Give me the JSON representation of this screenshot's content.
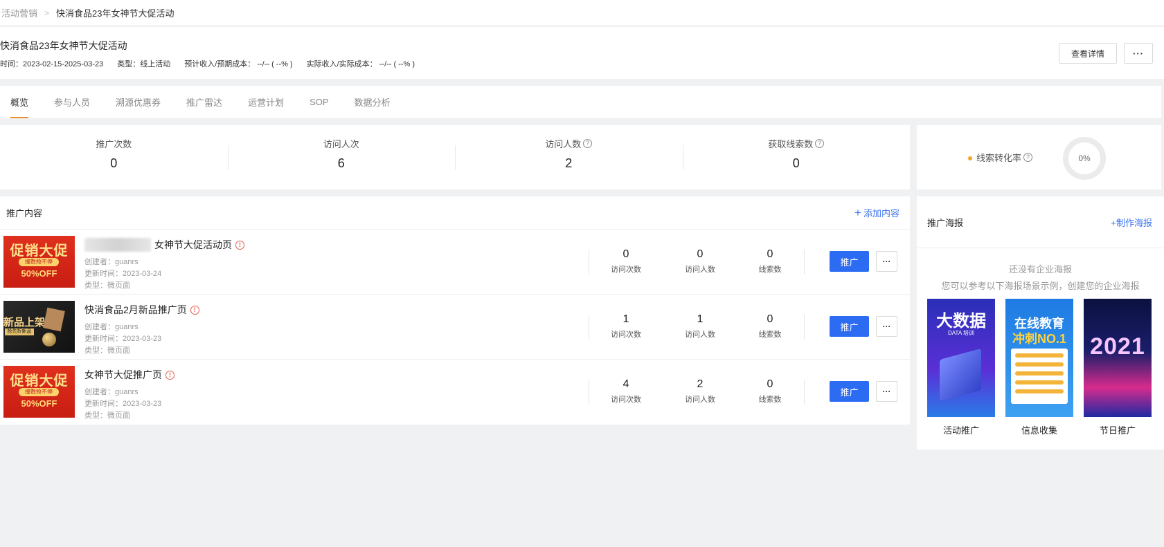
{
  "breadcrumb": {
    "parent": "活动营销",
    "current": "快消食品23年女神节大促活动"
  },
  "header": {
    "title": "快消食品23年女神节大促活动",
    "time": "时间：2023-02-15-2025-03-23",
    "type": "类型：线上活动",
    "expected": "预计收入/预期成本： --/-- ( --% )",
    "actual": "实际收入/实际成本： --/-- ( --% )",
    "detail_button": "查看详情",
    "more_button": "···"
  },
  "tabs": [
    "概览",
    "参与人员",
    "溯源优惠券",
    "推广雷达",
    "运营计划",
    "SOP",
    "数据分析"
  ],
  "stats": [
    {
      "label": "推广次数",
      "value": "0",
      "help": false
    },
    {
      "label": "访问人次",
      "value": "6",
      "help": false
    },
    {
      "label": "访问人数",
      "value": "2",
      "help": true
    },
    {
      "label": "获取线索数",
      "value": "0",
      "help": true
    }
  ],
  "conversion": {
    "label": "线索转化率",
    "value": "0%"
  },
  "content": {
    "title": "推广内容",
    "add": "添加内容",
    "promote_label": "推广",
    "more_label": "···",
    "rows": [
      {
        "title": "女神节大促活动页",
        "creator": "创建者：guanrs",
        "updated": "更新时间：2023-03-24",
        "type": "类型：微页面",
        "visits": "0",
        "visitors": "0",
        "leads": "0",
        "thumb": {
          "l1": "促销大促",
          "l2": "撞数抢不停",
          "l3": "50%OFF"
        }
      },
      {
        "title": "快消食品2月新品推广页",
        "creator": "创建者：guanrs",
        "updated": "更新时间：2023-03-23",
        "type": "类型：微页面",
        "visits": "1",
        "visitors": "1",
        "leads": "0",
        "thumb": {
          "l1": "新品上架",
          "l2": "抢先折新品"
        }
      },
      {
        "title": "女神节大促推广页",
        "creator": "创建者：guanrs",
        "updated": "更新时间：2023-03-23",
        "type": "类型：微页面",
        "visits": "4",
        "visitors": "2",
        "leads": "0",
        "thumb": {
          "l1": "促销大促",
          "l2": "撞数抢不停",
          "l3": "50%OFF"
        }
      }
    ],
    "metric_labels": {
      "visits": "访问次数",
      "visitors": "访问人数",
      "leads": "线索数"
    }
  },
  "posters": {
    "title": "推广海报",
    "make": "+制作海报",
    "empty_line1": "还没有企业海报",
    "empty_line2": "您可以参考以下海报场景示例，创建您的企业海报",
    "items": [
      {
        "label": "活动推广",
        "art": {
          "big": "大数据",
          "sub": "DATA 培训"
        }
      },
      {
        "label": "信息收集",
        "art": {
          "t1": "在线教育",
          "t2": "冲刺NO.1"
        }
      },
      {
        "label": "节日推广",
        "art": {
          "year": "2021"
        }
      }
    ]
  },
  "colors": {
    "accent": "#2b6cf3",
    "tab_underline": "#f08c2c",
    "link": "#3b73f0",
    "warning": "#e05b4c"
  }
}
